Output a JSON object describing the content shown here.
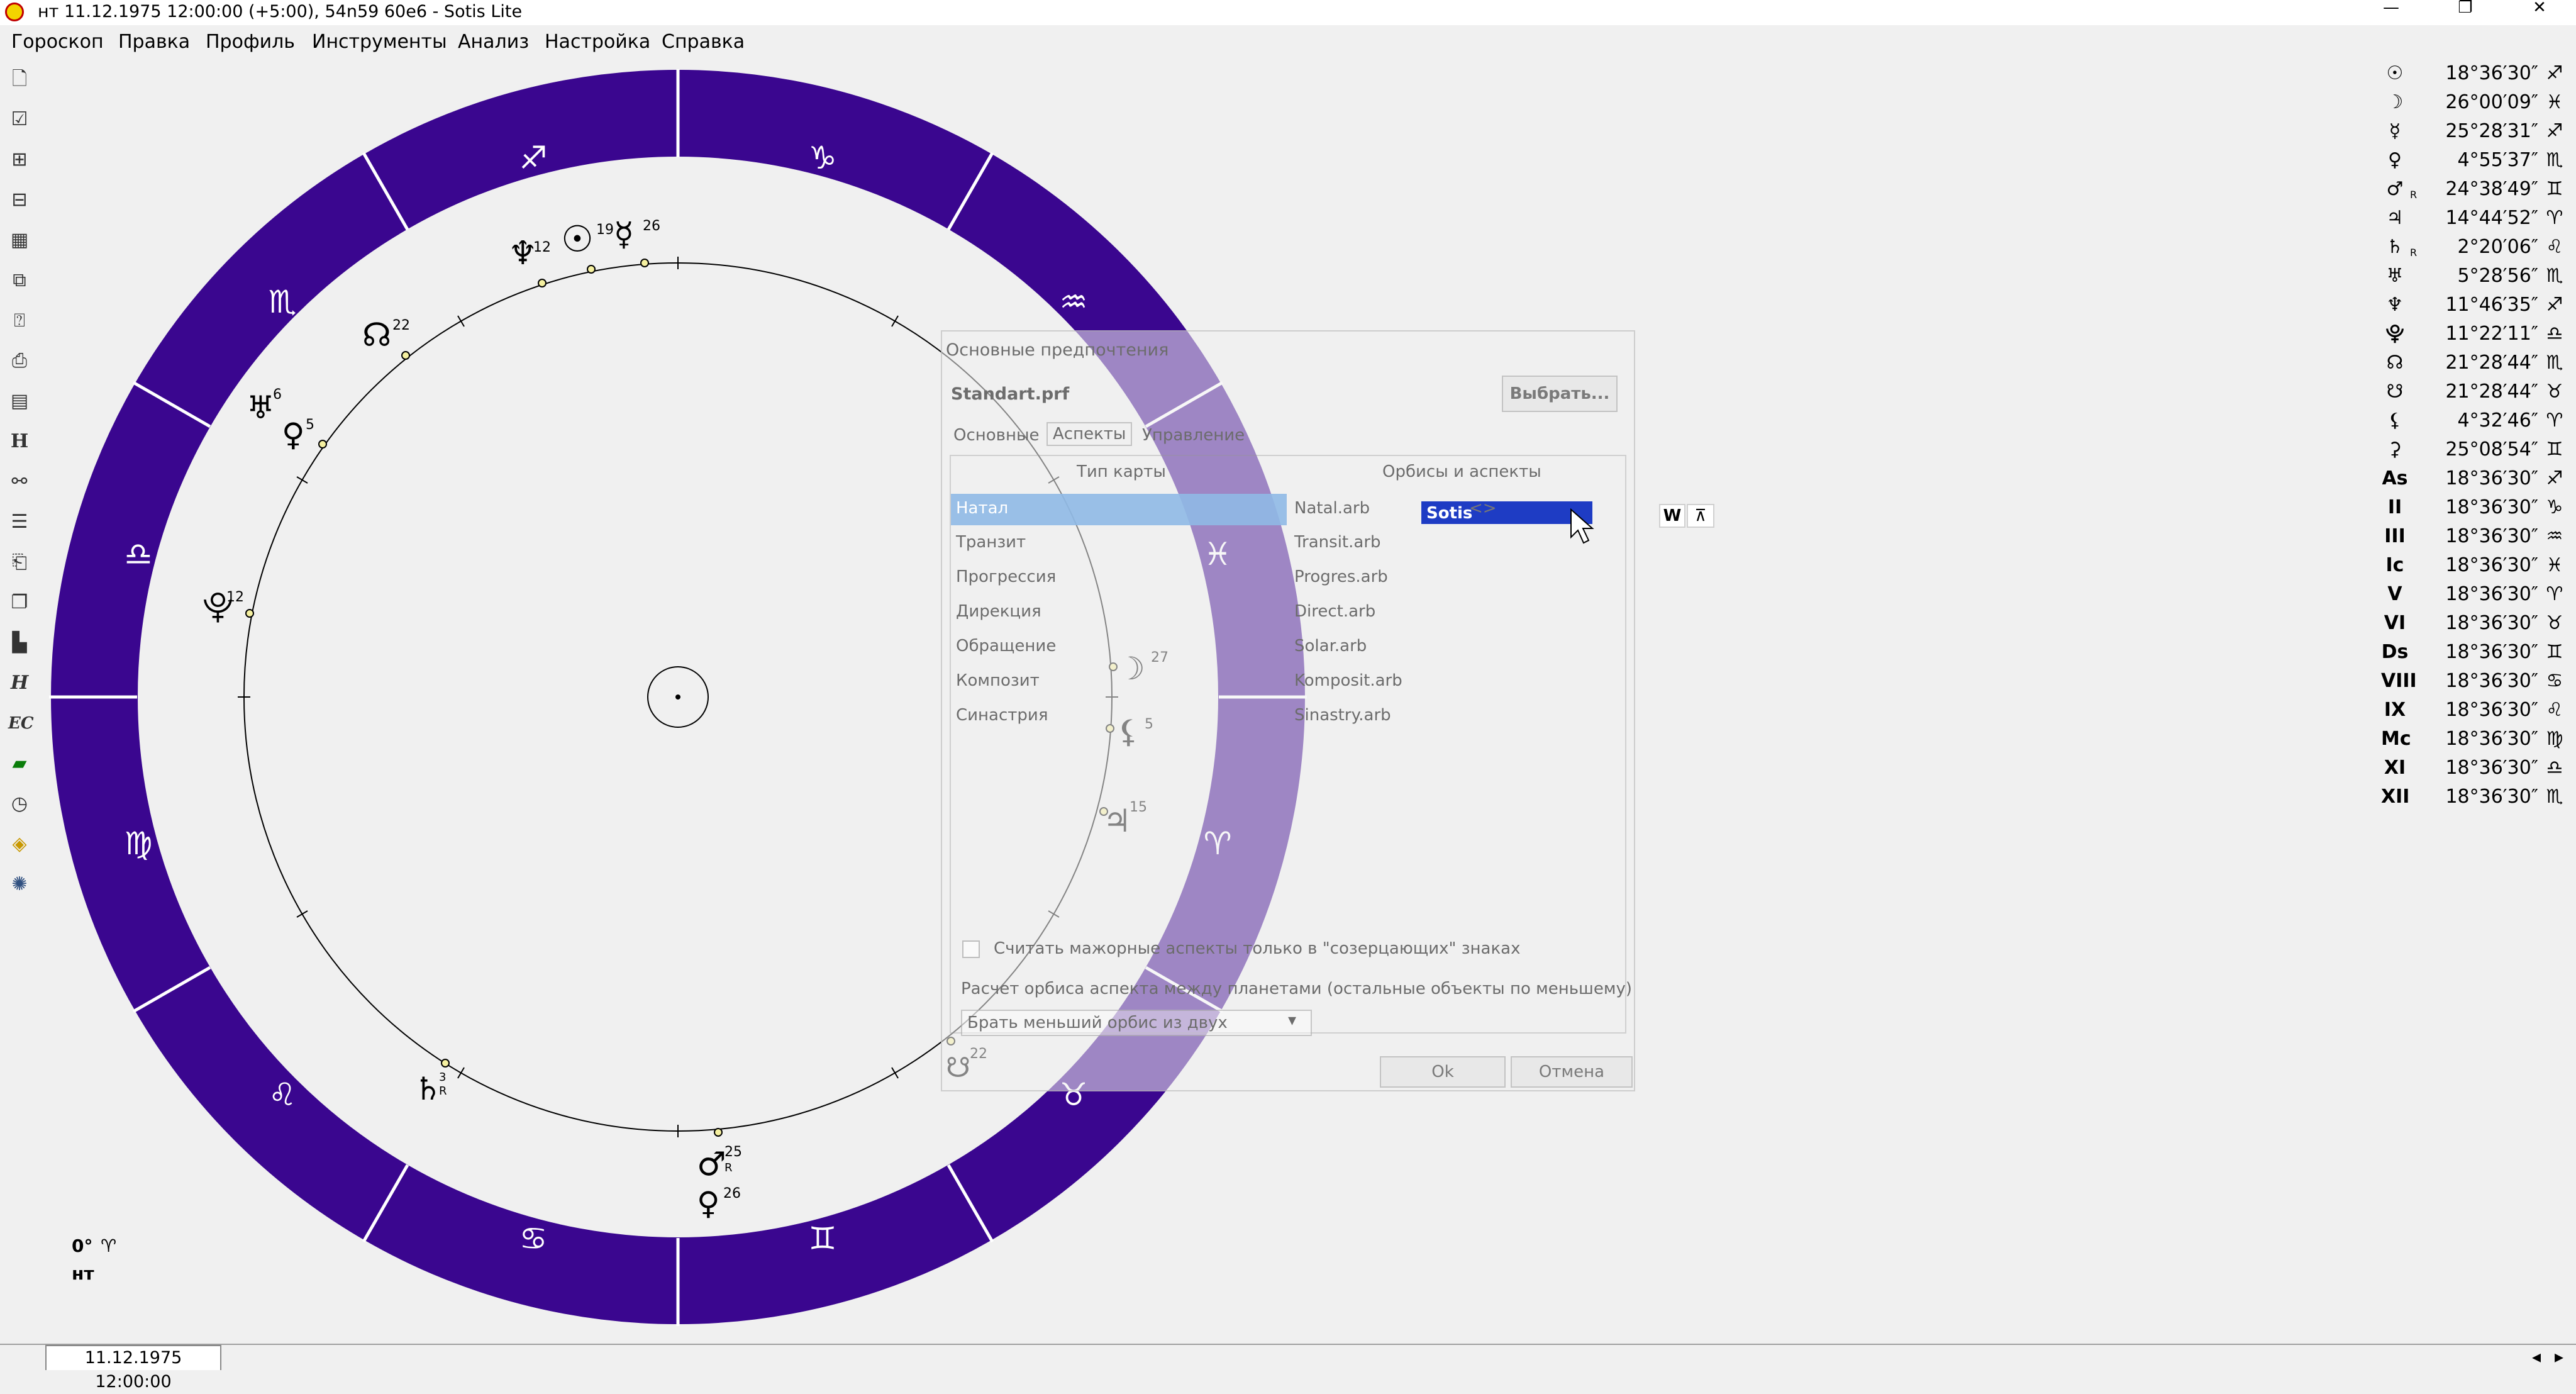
{
  "window": {
    "title": "нт 11.12.1975 12:00:00 (+5:00), 54n59 60e6 - Sotis Lite",
    "controls": [
      "—",
      "❐",
      "✕"
    ]
  },
  "menu": [
    "Гороскоп",
    "Правка",
    "Профиль",
    "Инструменты",
    "Анализ",
    "Настройка",
    "Справка"
  ],
  "toolbar": [
    "new-file-icon",
    "checklist-icon",
    "add-file-icon",
    "remove-file-icon",
    "image-icon",
    "copy-icon",
    "query-icon",
    "print-icon",
    "table-icon",
    "houses-icon",
    "aspects-icon",
    "list-icon",
    "export-icon",
    "cards-icon",
    "bars-icon",
    "h-icon",
    "ec-icon",
    "folder-icon",
    "clock-icon",
    "map-icon",
    "fan-icon"
  ],
  "colors": {
    "ring": "#3a068f",
    "ring_overlay": "#7d55b8",
    "selection": "#1e3cc4",
    "selection_light": "#8fb9e6"
  },
  "chart": {
    "zodiac_signs": [
      "♐",
      "♑",
      "♒",
      "♓",
      "♈",
      "♉",
      "♊",
      "♋",
      "♌",
      "♍",
      "♎",
      "♏"
    ],
    "planets": [
      {
        "glyph": "♆",
        "deg": "12"
      },
      {
        "glyph": "☉",
        "deg": "19"
      },
      {
        "glyph": "☿",
        "deg": "26"
      },
      {
        "glyph": "☊",
        "deg": "22"
      },
      {
        "glyph": "♅",
        "deg": "6"
      },
      {
        "glyph": "♀",
        "deg": "5"
      },
      {
        "glyph": "⯓",
        "deg": "12"
      },
      {
        "glyph": "☽",
        "deg": "27"
      },
      {
        "glyph": "⚸",
        "deg": "5"
      },
      {
        "glyph": "♃",
        "deg": "15"
      },
      {
        "glyph": "☋",
        "deg": "22"
      },
      {
        "glyph": "♄",
        "deg": "3"
      },
      {
        "glyph": "♂",
        "deg": "25"
      },
      {
        "glyph": "♀",
        "deg": "26"
      }
    ],
    "retro_marker": "R",
    "bottom_label_deg": "0°",
    "bottom_label_sign": "♈",
    "bottom_label_name": "нт"
  },
  "positions": [
    {
      "glyph": "☉",
      "r": "",
      "value": "18°36′30″",
      "sign": "♐"
    },
    {
      "glyph": "☽",
      "r": "",
      "value": "26°00′09″",
      "sign": "♓"
    },
    {
      "glyph": "☿",
      "r": "",
      "value": "25°28′31″",
      "sign": "♐"
    },
    {
      "glyph": "♀",
      "r": "",
      "value": "4°55′37″",
      "sign": "♏"
    },
    {
      "glyph": "♂",
      "r": "R",
      "value": "24°38′49″",
      "sign": "♊"
    },
    {
      "glyph": "♃",
      "r": "",
      "value": "14°44′52″",
      "sign": "♈"
    },
    {
      "glyph": "♄",
      "r": "R",
      "value": "2°20′06″",
      "sign": "♌"
    },
    {
      "glyph": "♅",
      "r": "",
      "value": "5°28′56″",
      "sign": "♏"
    },
    {
      "glyph": "♆",
      "r": "",
      "value": "11°46′35″",
      "sign": "♐"
    },
    {
      "glyph": "⯓",
      "r": "",
      "value": "11°22′11″",
      "sign": "♎"
    },
    {
      "glyph": "☊",
      "r": "",
      "value": "21°28′44″",
      "sign": "♏"
    },
    {
      "glyph": "☋",
      "r": "",
      "value": "21°28′44″",
      "sign": "♉"
    },
    {
      "glyph": "⚸",
      "r": "",
      "value": "4°32′46″",
      "sign": "♈"
    },
    {
      "glyph": "⚳",
      "r": "",
      "value": "25°08′54″",
      "sign": "♊"
    },
    {
      "glyph": "As",
      "r": "",
      "value": "18°36′30″",
      "sign": "♐"
    },
    {
      "glyph": "II",
      "r": "",
      "value": "18°36′30″",
      "sign": "♑"
    },
    {
      "glyph": "III",
      "r": "",
      "value": "18°36′30″",
      "sign": "♒"
    },
    {
      "glyph": "Ic",
      "r": "",
      "value": "18°36′30″",
      "sign": "♓"
    },
    {
      "glyph": "V",
      "r": "",
      "value": "18°36′30″",
      "sign": "♈"
    },
    {
      "glyph": "VI",
      "r": "",
      "value": "18°36′30″",
      "sign": "♉"
    },
    {
      "glyph": "Ds",
      "r": "",
      "value": "18°36′30″",
      "sign": "♊"
    },
    {
      "glyph": "VIII",
      "r": "",
      "value": "18°36′30″",
      "sign": "♋"
    },
    {
      "glyph": "IX",
      "r": "",
      "value": "18°36′30″",
      "sign": "♌"
    },
    {
      "glyph": "Mc",
      "r": "",
      "value": "18°36′30″",
      "sign": "♍"
    },
    {
      "glyph": "XI",
      "r": "",
      "value": "18°36′30″",
      "sign": "♎"
    },
    {
      "glyph": "XII",
      "r": "",
      "value": "18°36′30″",
      "sign": "♏"
    }
  ],
  "dialog": {
    "title": "Основные предпочтения",
    "profile": "Standart.prf",
    "choose_button": "Выбрать...",
    "tabs": [
      "Основные",
      "Аспекты",
      "Управление"
    ],
    "col_type": "Тип карты",
    "col_orbs": "Орбисы и аспекты",
    "rows": [
      {
        "type": "Натал",
        "file": "Natal.arb"
      },
      {
        "type": "Транзит",
        "file": "Transit.arb"
      },
      {
        "type": "Прогрессия",
        "file": "Progres.arb"
      },
      {
        "type": "Дирекция",
        "file": "Direct.arb"
      },
      {
        "type": "Обращение",
        "file": "Solar.arb"
      },
      {
        "type": "Композит",
        "file": "Komposit.arb"
      },
      {
        "type": "Синастрия",
        "file": "Sinastry.arb"
      }
    ],
    "dropdown_value": "Sotis",
    "dropdown_extra": "<>",
    "w_label": "W",
    "checkbox_label": "Считать мажорные аспекты только в \"созерцающих\" знаках",
    "orb_calc_label": "Расчет орбиса аспекта между планетами (остальные объекты по меньшему)",
    "orb_select_value": "Брать меньший орбис из двух",
    "ok": "Ok",
    "cancel": "Отмена"
  },
  "bottom_tab": "11.12.1975 12:00:00"
}
